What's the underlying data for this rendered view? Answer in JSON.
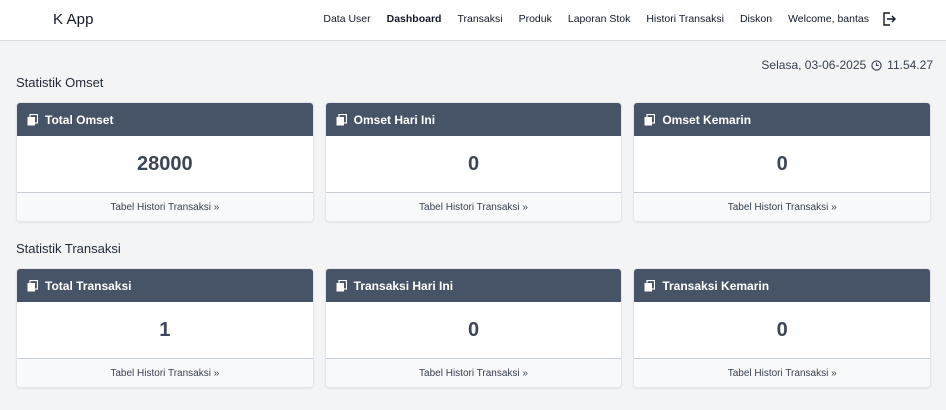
{
  "app": {
    "brand": "K App"
  },
  "nav": {
    "links": [
      {
        "label": "Data User"
      },
      {
        "label": "Dashboard",
        "active": true
      },
      {
        "label": "Transaksi"
      },
      {
        "label": "Produk"
      },
      {
        "label": "Laporan Stok"
      },
      {
        "label": "Histori Transaksi"
      },
      {
        "label": "Diskon"
      },
      {
        "label": "Welcome, bantas"
      }
    ],
    "logout_icon": "logout-icon"
  },
  "datetime": {
    "date": "Selasa, 03-06-2025",
    "time": "11.54.27",
    "icon": "clock-icon"
  },
  "sections": [
    {
      "title": "Statistik Omset",
      "cards": [
        {
          "header": "Total Omset",
          "value": "28000",
          "footer": "Tabel Histori Transaksi »"
        },
        {
          "header": "Omset Hari Ini",
          "value": "0",
          "footer": "Tabel Histori Transaksi »"
        },
        {
          "header": "Omset Kemarin",
          "value": "0",
          "footer": "Tabel Histori Transaksi »"
        }
      ]
    },
    {
      "title": "Statistik Transaksi",
      "cards": [
        {
          "header": "Total Transaksi",
          "value": "1",
          "footer": "Tabel Histori Transaksi »"
        },
        {
          "header": "Transaksi Hari Ini",
          "value": "0",
          "footer": "Tabel Histori Transaksi »"
        },
        {
          "header": "Transaksi Kemarin",
          "value": "0",
          "footer": "Tabel Histori Transaksi »"
        }
      ]
    }
  ],
  "colors": {
    "card_header": "#475366",
    "value_text": "#3c4656",
    "page_bg": "#f3f4f6"
  }
}
